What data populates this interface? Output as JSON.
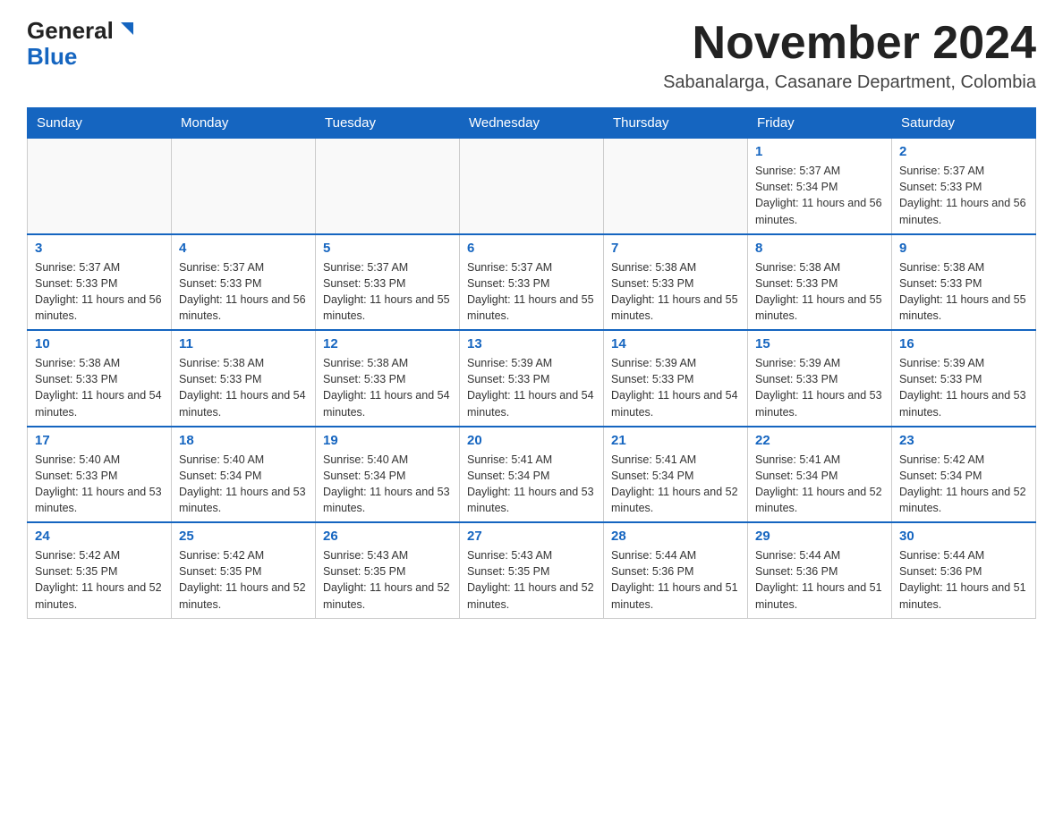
{
  "logo": {
    "general": "General",
    "blue": "Blue"
  },
  "header": {
    "month_year": "November 2024",
    "location": "Sabanalarga, Casanare Department, Colombia"
  },
  "days_of_week": [
    "Sunday",
    "Monday",
    "Tuesday",
    "Wednesday",
    "Thursday",
    "Friday",
    "Saturday"
  ],
  "weeks": [
    [
      {
        "day": "",
        "info": ""
      },
      {
        "day": "",
        "info": ""
      },
      {
        "day": "",
        "info": ""
      },
      {
        "day": "",
        "info": ""
      },
      {
        "day": "",
        "info": ""
      },
      {
        "day": "1",
        "info": "Sunrise: 5:37 AM\nSunset: 5:34 PM\nDaylight: 11 hours and 56 minutes."
      },
      {
        "day": "2",
        "info": "Sunrise: 5:37 AM\nSunset: 5:33 PM\nDaylight: 11 hours and 56 minutes."
      }
    ],
    [
      {
        "day": "3",
        "info": "Sunrise: 5:37 AM\nSunset: 5:33 PM\nDaylight: 11 hours and 56 minutes."
      },
      {
        "day": "4",
        "info": "Sunrise: 5:37 AM\nSunset: 5:33 PM\nDaylight: 11 hours and 56 minutes."
      },
      {
        "day": "5",
        "info": "Sunrise: 5:37 AM\nSunset: 5:33 PM\nDaylight: 11 hours and 55 minutes."
      },
      {
        "day": "6",
        "info": "Sunrise: 5:37 AM\nSunset: 5:33 PM\nDaylight: 11 hours and 55 minutes."
      },
      {
        "day": "7",
        "info": "Sunrise: 5:38 AM\nSunset: 5:33 PM\nDaylight: 11 hours and 55 minutes."
      },
      {
        "day": "8",
        "info": "Sunrise: 5:38 AM\nSunset: 5:33 PM\nDaylight: 11 hours and 55 minutes."
      },
      {
        "day": "9",
        "info": "Sunrise: 5:38 AM\nSunset: 5:33 PM\nDaylight: 11 hours and 55 minutes."
      }
    ],
    [
      {
        "day": "10",
        "info": "Sunrise: 5:38 AM\nSunset: 5:33 PM\nDaylight: 11 hours and 54 minutes."
      },
      {
        "day": "11",
        "info": "Sunrise: 5:38 AM\nSunset: 5:33 PM\nDaylight: 11 hours and 54 minutes."
      },
      {
        "day": "12",
        "info": "Sunrise: 5:38 AM\nSunset: 5:33 PM\nDaylight: 11 hours and 54 minutes."
      },
      {
        "day": "13",
        "info": "Sunrise: 5:39 AM\nSunset: 5:33 PM\nDaylight: 11 hours and 54 minutes."
      },
      {
        "day": "14",
        "info": "Sunrise: 5:39 AM\nSunset: 5:33 PM\nDaylight: 11 hours and 54 minutes."
      },
      {
        "day": "15",
        "info": "Sunrise: 5:39 AM\nSunset: 5:33 PM\nDaylight: 11 hours and 53 minutes."
      },
      {
        "day": "16",
        "info": "Sunrise: 5:39 AM\nSunset: 5:33 PM\nDaylight: 11 hours and 53 minutes."
      }
    ],
    [
      {
        "day": "17",
        "info": "Sunrise: 5:40 AM\nSunset: 5:33 PM\nDaylight: 11 hours and 53 minutes."
      },
      {
        "day": "18",
        "info": "Sunrise: 5:40 AM\nSunset: 5:34 PM\nDaylight: 11 hours and 53 minutes."
      },
      {
        "day": "19",
        "info": "Sunrise: 5:40 AM\nSunset: 5:34 PM\nDaylight: 11 hours and 53 minutes."
      },
      {
        "day": "20",
        "info": "Sunrise: 5:41 AM\nSunset: 5:34 PM\nDaylight: 11 hours and 53 minutes."
      },
      {
        "day": "21",
        "info": "Sunrise: 5:41 AM\nSunset: 5:34 PM\nDaylight: 11 hours and 52 minutes."
      },
      {
        "day": "22",
        "info": "Sunrise: 5:41 AM\nSunset: 5:34 PM\nDaylight: 11 hours and 52 minutes."
      },
      {
        "day": "23",
        "info": "Sunrise: 5:42 AM\nSunset: 5:34 PM\nDaylight: 11 hours and 52 minutes."
      }
    ],
    [
      {
        "day": "24",
        "info": "Sunrise: 5:42 AM\nSunset: 5:35 PM\nDaylight: 11 hours and 52 minutes."
      },
      {
        "day": "25",
        "info": "Sunrise: 5:42 AM\nSunset: 5:35 PM\nDaylight: 11 hours and 52 minutes."
      },
      {
        "day": "26",
        "info": "Sunrise: 5:43 AM\nSunset: 5:35 PM\nDaylight: 11 hours and 52 minutes."
      },
      {
        "day": "27",
        "info": "Sunrise: 5:43 AM\nSunset: 5:35 PM\nDaylight: 11 hours and 52 minutes."
      },
      {
        "day": "28",
        "info": "Sunrise: 5:44 AM\nSunset: 5:36 PM\nDaylight: 11 hours and 51 minutes."
      },
      {
        "day": "29",
        "info": "Sunrise: 5:44 AM\nSunset: 5:36 PM\nDaylight: 11 hours and 51 minutes."
      },
      {
        "day": "30",
        "info": "Sunrise: 5:44 AM\nSunset: 5:36 PM\nDaylight: 11 hours and 51 minutes."
      }
    ]
  ]
}
